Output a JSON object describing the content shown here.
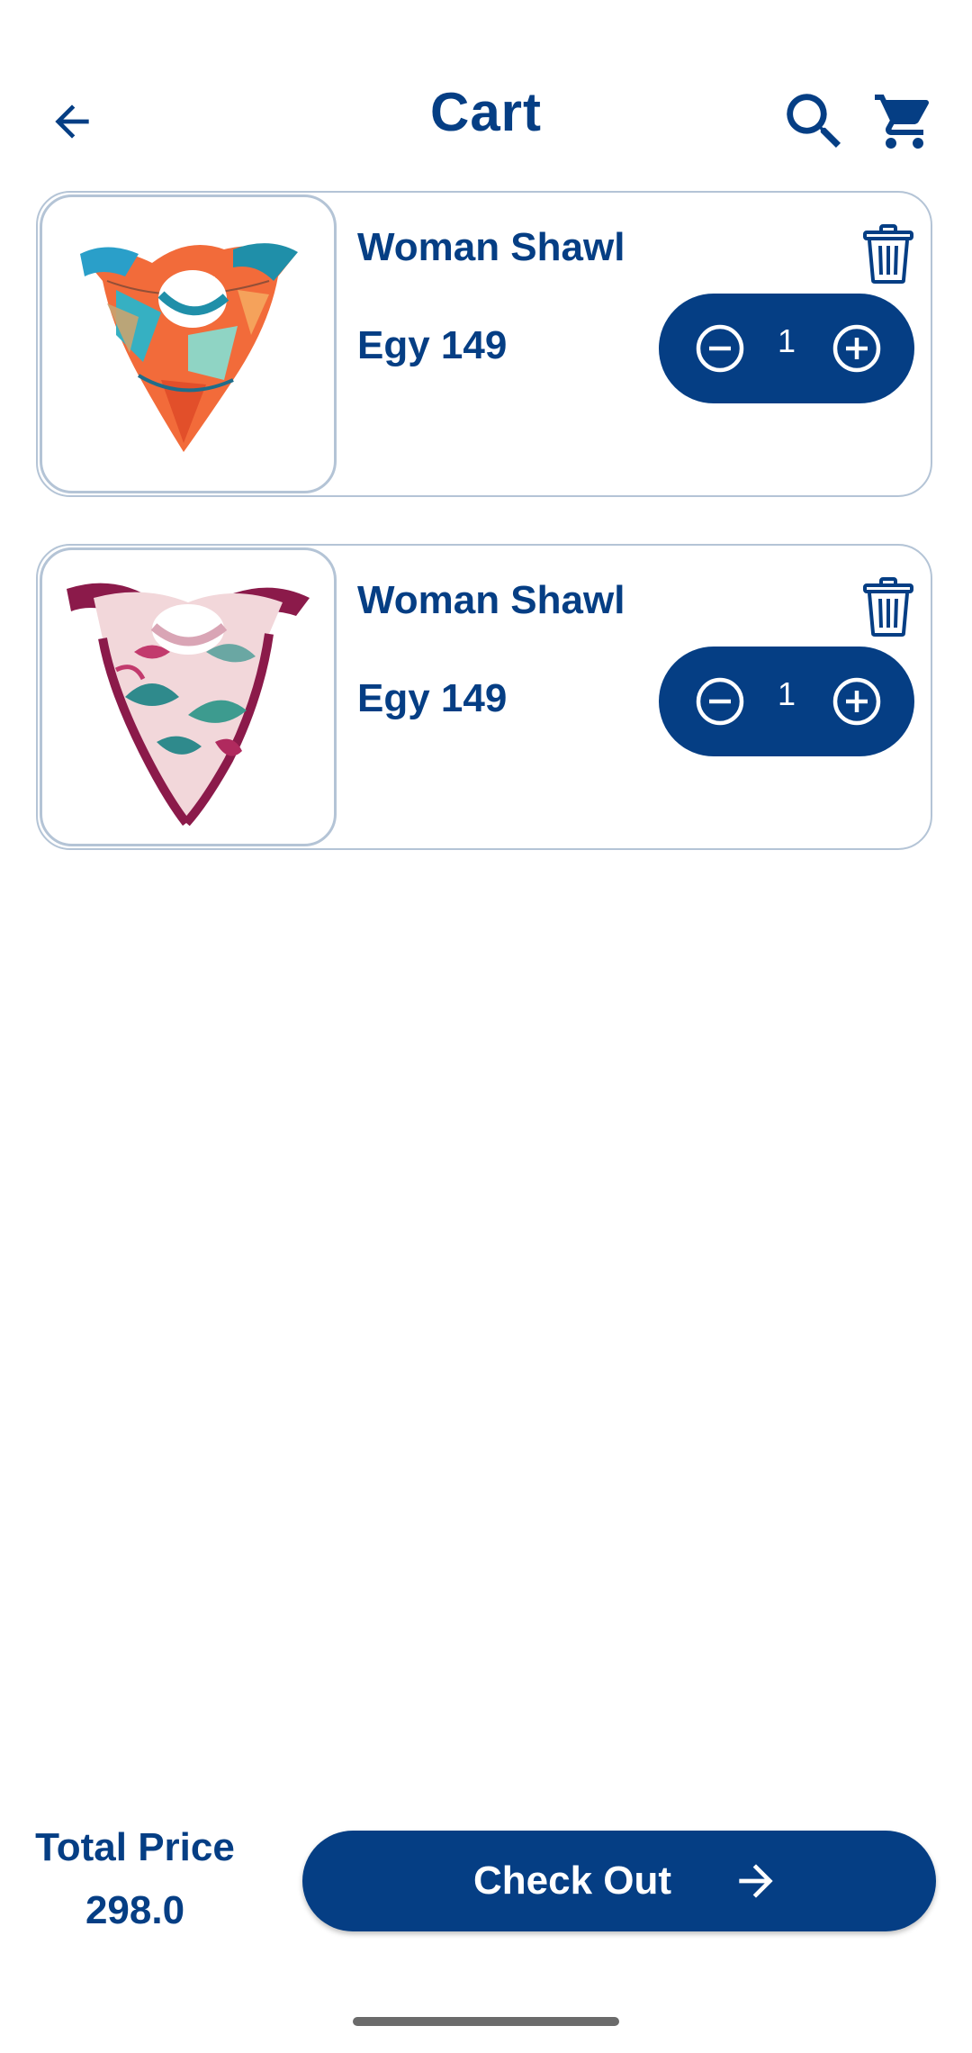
{
  "header": {
    "title": "Cart",
    "back_icon": "arrow-left-icon",
    "search_icon": "search-icon",
    "cart_icon": "cart-icon"
  },
  "items": [
    {
      "name": "Woman Shawl",
      "price": "Egy 149",
      "quantity": "1",
      "image": "scarf-orange-teal"
    },
    {
      "name": "Woman Shawl",
      "price": "Egy 149",
      "quantity": "1",
      "image": "scarf-pink-magenta"
    }
  ],
  "footer": {
    "total_label": "Total Price",
    "total_value": "298.0",
    "checkout_label": "Check Out"
  },
  "colors": {
    "primary": "#053e84",
    "border": "#b4c4d6",
    "background": "#ffffff"
  }
}
